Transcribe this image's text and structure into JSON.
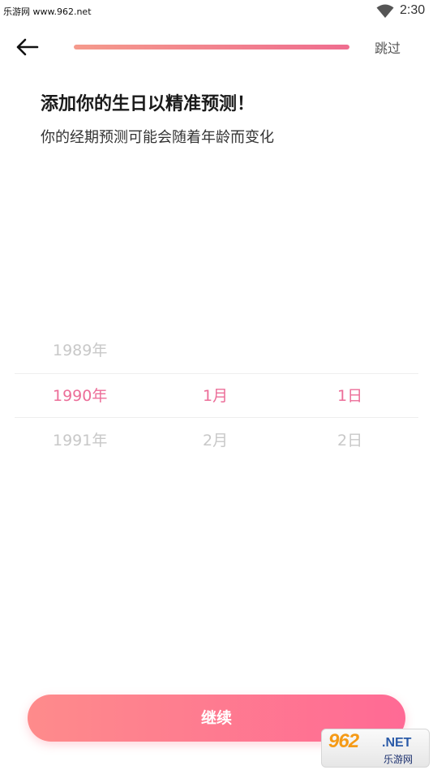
{
  "status_bar": {
    "watermark": "乐游网 www.962.net",
    "time": "2:30"
  },
  "header": {
    "skip_label": "跳过",
    "progress": 1.0
  },
  "title": "添加你的生日以精准预测！",
  "subtitle": "你的经期预测可能会随着年龄而变化",
  "picker": {
    "rows": [
      {
        "year": "1989年",
        "month": "",
        "day": ""
      },
      {
        "year": "1990年",
        "month": "1月",
        "day": "1日"
      },
      {
        "year": "1991年",
        "month": "2月",
        "day": "2日"
      }
    ]
  },
  "continue_label": "继续",
  "logo": {
    "main": "962",
    "net": ".NET",
    "sub": "乐游网"
  },
  "colors": {
    "accent": "#ec6d98",
    "button_start": "#fe8b8b",
    "button_end": "#ff6a95"
  }
}
